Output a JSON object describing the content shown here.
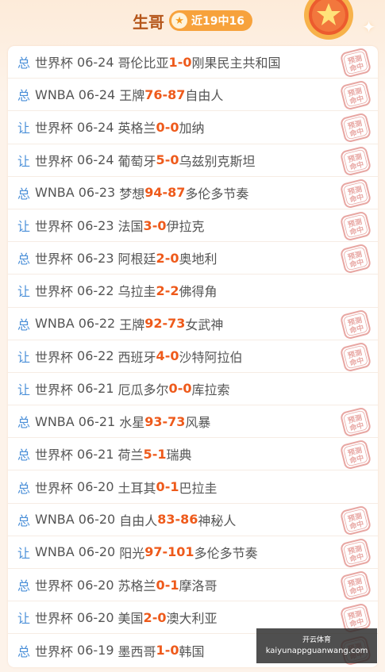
{
  "header": {
    "title": "生哥",
    "record": "近19中16"
  },
  "stamp_text": "预测命中",
  "rows": [
    {
      "type": "总",
      "league": "世界杯",
      "date": "06-24",
      "home": "哥伦比亚",
      "home_score": "1",
      "sep": " - ",
      "away_score": "0",
      "away": "刚果民主共和国",
      "hit": true
    },
    {
      "type": "总",
      "league": "WNBA",
      "date": "06-24",
      "home": "王牌",
      "home_score": "76",
      "sep": " - ",
      "away_score": "87",
      "away": "自由人",
      "hit": true
    },
    {
      "type": "让",
      "league": "世界杯",
      "date": "06-24",
      "home": "英格兰",
      "home_score": "0",
      "sep": " - ",
      "away_score": "0",
      "away": "加纳",
      "hit": true
    },
    {
      "type": "让",
      "league": "世界杯",
      "date": "06-24",
      "home": "葡萄牙",
      "home_score": "5",
      "sep": " - ",
      "away_score": "0",
      "away": "乌兹别克斯坦",
      "hit": true
    },
    {
      "type": "总",
      "league": "WNBA",
      "date": "06-23",
      "home": "梦想",
      "home_score": "94",
      "sep": " - ",
      "away_score": "87",
      "away": "多伦多节奏",
      "hit": true
    },
    {
      "type": "让",
      "league": "世界杯",
      "date": "06-23",
      "home": "法国",
      "home_score": "3",
      "sep": " - ",
      "away_score": "0",
      "away": "伊拉克",
      "hit": true
    },
    {
      "type": "总",
      "league": "世界杯",
      "date": "06-23",
      "home": "阿根廷",
      "home_score": "2",
      "sep": " - ",
      "away_score": "0",
      "away": "奥地利",
      "hit": true
    },
    {
      "type": "让",
      "league": "世界杯",
      "date": "06-22",
      "home": "乌拉圭",
      "home_score": "2",
      "sep": " - ",
      "away_score": "2",
      "away": "佛得角",
      "hit": false
    },
    {
      "type": "总",
      "league": "WNBA",
      "date": "06-22",
      "home": "王牌",
      "home_score": "92",
      "sep": " - ",
      "away_score": "73",
      "away": "女武神",
      "hit": true
    },
    {
      "type": "让",
      "league": "世界杯",
      "date": "06-22",
      "home": "西班牙",
      "home_score": "4",
      "sep": " - ",
      "away_score": "0",
      "away": "沙特阿拉伯",
      "hit": true
    },
    {
      "type": "让",
      "league": "世界杯",
      "date": "06-21",
      "home": "厄瓜多尔",
      "home_score": "0",
      "sep": " - ",
      "away_score": "0",
      "away": "库拉索",
      "hit": false
    },
    {
      "type": "总",
      "league": "WNBA",
      "date": "06-21",
      "home": "水星",
      "home_score": "93",
      "sep": " - ",
      "away_score": "73",
      "away": "风暴",
      "hit": true
    },
    {
      "type": "总",
      "league": "世界杯",
      "date": "06-21",
      "home": "荷兰",
      "home_score": "5",
      "sep": " - ",
      "away_score": "1",
      "away": "瑞典",
      "hit": true
    },
    {
      "type": "总",
      "league": "世界杯",
      "date": "06-20",
      "home": "土耳其",
      "home_score": "0",
      "sep": " - ",
      "away_score": "1",
      "away": "巴拉圭",
      "hit": false
    },
    {
      "type": "总",
      "league": "WNBA",
      "date": "06-20",
      "home": "自由人",
      "home_score": "83",
      "sep": " - ",
      "away_score": "86",
      "away": "神秘人",
      "hit": true
    },
    {
      "type": "让",
      "league": "WNBA",
      "date": "06-20",
      "home": "阳光",
      "home_score": "97",
      "sep": " - ",
      "away_score": "101",
      "away": "多伦多节奏",
      "hit": true
    },
    {
      "type": "总",
      "league": "世界杯",
      "date": "06-20",
      "home": "苏格兰",
      "home_score": "0",
      "sep": " - ",
      "away_score": "1",
      "away": "摩洛哥",
      "hit": true
    },
    {
      "type": "让",
      "league": "世界杯",
      "date": "06-20",
      "home": "美国",
      "home_score": "2",
      "sep": " - ",
      "away_score": "0",
      "away": "澳大利亚",
      "hit": true
    },
    {
      "type": "总",
      "league": "世界杯",
      "date": "06-19",
      "home": "墨西哥",
      "home_score": "1",
      "sep": " - ",
      "away_score": "0",
      "away": "韩国",
      "hit": true
    }
  ],
  "watermark": {
    "top": "开云体育",
    "url": "kaiyunappguanwang.com"
  },
  "colors": {
    "accent": "#ee5a1b",
    "type_blue": "#4a8fd8",
    "stamp_red": "#e8a7a3",
    "title_brown": "#b5561b",
    "badge_orange": "#f7a23c"
  }
}
